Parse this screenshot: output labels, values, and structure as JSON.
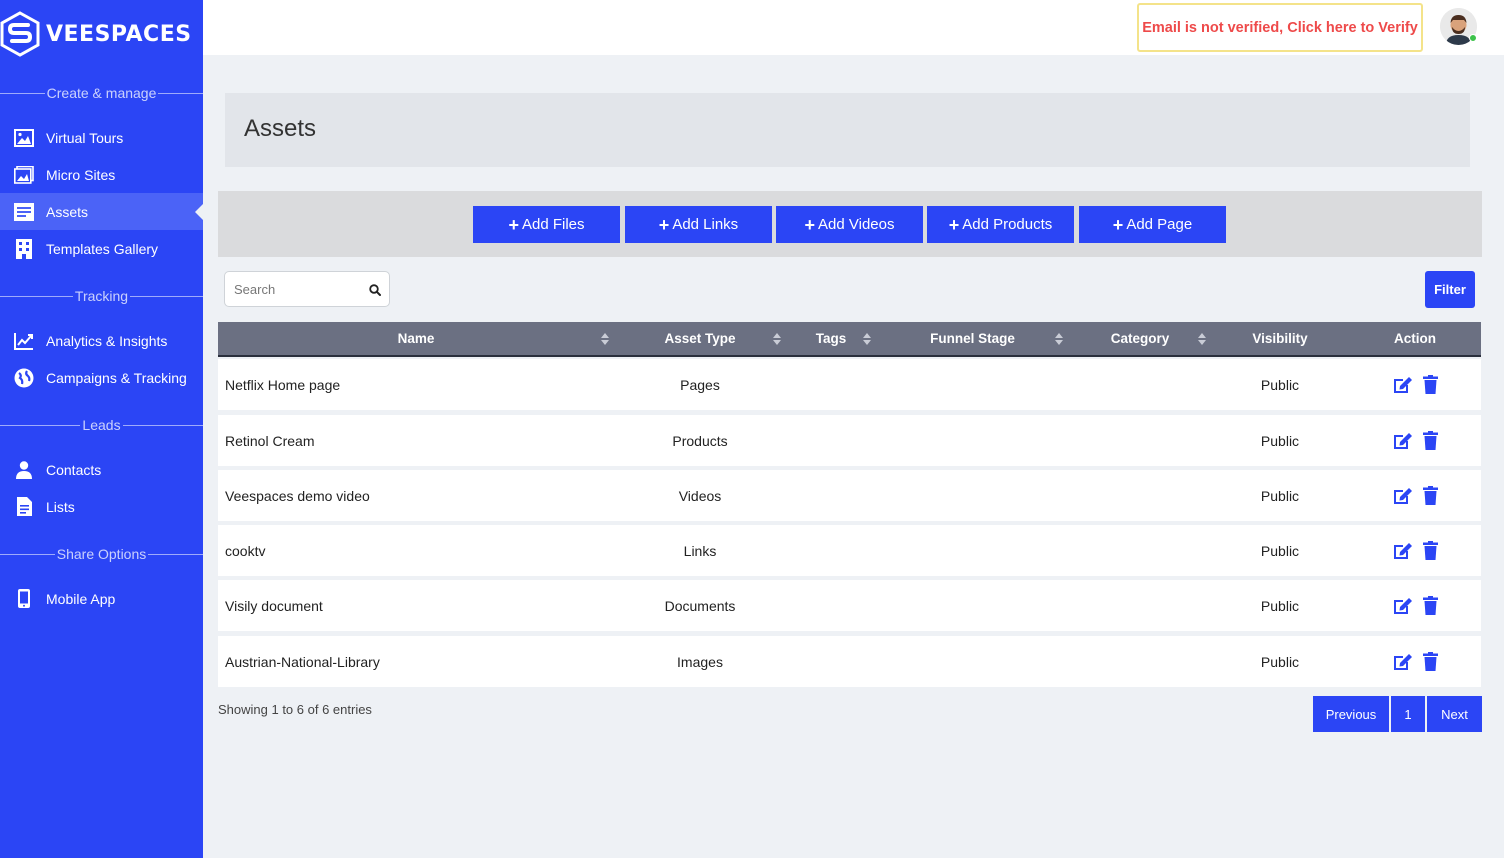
{
  "brand": {
    "name": "VEESPACES"
  },
  "sidebar": {
    "sections": [
      {
        "title": "Create & manage"
      },
      {
        "title": "Tracking"
      },
      {
        "title": "Leads"
      },
      {
        "title": "Share Options"
      }
    ],
    "items": [
      {
        "label": "Virtual Tours",
        "icon": "image-icon"
      },
      {
        "label": "Micro Sites",
        "icon": "images-icon"
      },
      {
        "label": "Assets",
        "icon": "asset-list-icon",
        "active": true
      },
      {
        "label": "Templates Gallery",
        "icon": "building-icon"
      },
      {
        "label": "Analytics & Insights",
        "icon": "chart-line-icon"
      },
      {
        "label": "Campaigns & Tracking",
        "icon": "globe-icon"
      },
      {
        "label": "Contacts",
        "icon": "user-icon"
      },
      {
        "label": "Lists",
        "icon": "document-icon"
      },
      {
        "label": "Mobile App",
        "icon": "mobile-icon"
      }
    ]
  },
  "topbar": {
    "verify_text": "Email is not verified, Click here to Verify"
  },
  "page": {
    "title": "Assets"
  },
  "toolbar": {
    "buttons": [
      "Add Files",
      "Add Links",
      "Add Videos",
      "Add Products",
      "Add Page"
    ]
  },
  "search": {
    "placeholder": "Search"
  },
  "filter": {
    "label": "Filter"
  },
  "table": {
    "columns": [
      "Name",
      "Asset Type",
      "Tags",
      "Funnel Stage",
      "Category",
      "Visibility",
      "Action"
    ],
    "rows": [
      {
        "name": "Netflix Home page",
        "type": "Pages",
        "tags": "",
        "funnel": "",
        "category": "",
        "visibility": "Public"
      },
      {
        "name": "Retinol Cream",
        "type": "Products",
        "tags": "",
        "funnel": "",
        "category": "",
        "visibility": "Public"
      },
      {
        "name": "Veespaces demo video",
        "type": "Videos",
        "tags": "",
        "funnel": "",
        "category": "",
        "visibility": "Public"
      },
      {
        "name": "cooktv",
        "type": "Links",
        "tags": "",
        "funnel": "",
        "category": "",
        "visibility": "Public"
      },
      {
        "name": "Visily document",
        "type": "Documents",
        "tags": "",
        "funnel": "",
        "category": "",
        "visibility": "Public"
      },
      {
        "name": "Austrian-National-Library",
        "type": "Images",
        "tags": "",
        "funnel": "",
        "category": "",
        "visibility": "Public"
      }
    ]
  },
  "pagination": {
    "info": "Showing 1 to 6 of 6 entries",
    "previous": "Previous",
    "current": "1",
    "next": "Next"
  },
  "colors": {
    "primary": "#2b45f5",
    "table_header": "#6b7082",
    "warning_text": "#ee4a4a",
    "warning_border": "#f4e38a"
  }
}
